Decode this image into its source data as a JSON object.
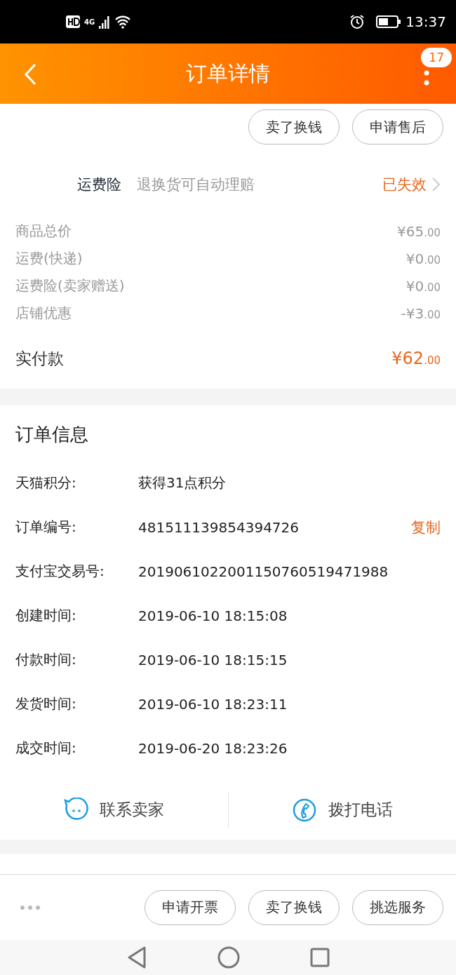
{
  "status_bar": {
    "network": "4G",
    "time": "13:37"
  },
  "header": {
    "title": "订单详情",
    "badge": "17"
  },
  "top_actions": [
    "卖了换钱",
    "申请售后"
  ],
  "insurance": {
    "name": "运费险",
    "description": "退换货可自动理赔",
    "status": "已失效"
  },
  "price_rows": [
    {
      "label": "商品总价",
      "amount": "¥65",
      "cents": ".00"
    },
    {
      "label": "运费(快递)",
      "amount": "¥0",
      "cents": ".00"
    },
    {
      "label": "运费险(卖家赠送)",
      "amount": "¥0",
      "cents": ".00"
    },
    {
      "label": "店铺优惠",
      "amount": "-¥3",
      "cents": ".00"
    }
  ],
  "total": {
    "label": "实付款",
    "amount": "¥62",
    "cents": ".00"
  },
  "order_info": {
    "title": "订单信息",
    "rows": [
      {
        "label": "天猫积分:",
        "value": "获得31点积分"
      },
      {
        "label": "订单编号:",
        "value": "481511139854394726",
        "action": "复制"
      },
      {
        "label": "支付宝交易号:",
        "value": "2019061022001150760519471988"
      },
      {
        "label": "创建时间:",
        "value": "2019-06-10 18:15:08"
      },
      {
        "label": "付款时间:",
        "value": "2019-06-10 18:15:15"
      },
      {
        "label": "发货时间:",
        "value": "2019-06-10 18:23:11"
      },
      {
        "label": "成交时间:",
        "value": "2019-06-20 18:23:26"
      }
    ]
  },
  "contact": [
    {
      "kind": "chat",
      "label": "联系卖家"
    },
    {
      "kind": "phone",
      "label": "拨打电话"
    }
  ],
  "bottom_actions": [
    "申请开票",
    "卖了换钱",
    "挑选服务"
  ]
}
